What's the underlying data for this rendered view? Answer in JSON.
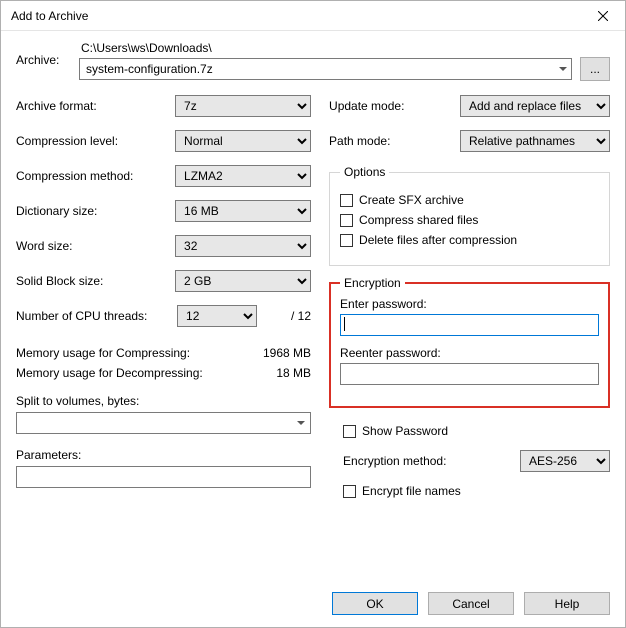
{
  "window": {
    "title": "Add to Archive"
  },
  "archive": {
    "label": "Archive:",
    "path": "C:\\Users\\ws\\Downloads\\",
    "filename": "system-configuration.7z",
    "browse": "..."
  },
  "left": {
    "format": {
      "label": "Archive format:",
      "value": "7z"
    },
    "level": {
      "label": "Compression level:",
      "value": "Normal"
    },
    "method": {
      "label": "Compression method:",
      "value": "LZMA2"
    },
    "dict": {
      "label": "Dictionary size:",
      "value": "16 MB"
    },
    "word": {
      "label": "Word size:",
      "value": "32"
    },
    "block": {
      "label": "Solid Block size:",
      "value": "2 GB"
    },
    "threads": {
      "label": "Number of CPU threads:",
      "value": "12",
      "suffix": "/ 12"
    },
    "mem_comp": {
      "label": "Memory usage for Compressing:",
      "value": "1968 MB"
    },
    "mem_decomp": {
      "label": "Memory usage for Decompressing:",
      "value": "18 MB"
    },
    "split": {
      "label": "Split to volumes, bytes:",
      "value": ""
    },
    "params": {
      "label": "Parameters:",
      "value": ""
    }
  },
  "right": {
    "update": {
      "label": "Update mode:",
      "value": "Add and replace files"
    },
    "pathmode": {
      "label": "Path mode:",
      "value": "Relative pathnames"
    },
    "options": {
      "legend": "Options",
      "sfx": "Create SFX archive",
      "shared": "Compress shared files",
      "delete": "Delete files after compression"
    },
    "encryption": {
      "legend": "Encryption",
      "enter": "Enter password:",
      "reenter": "Reenter password:",
      "show": "Show Password",
      "method_label": "Encryption method:",
      "method_value": "AES-256",
      "names": "Encrypt file names"
    }
  },
  "buttons": {
    "ok": "OK",
    "cancel": "Cancel",
    "help": "Help"
  }
}
